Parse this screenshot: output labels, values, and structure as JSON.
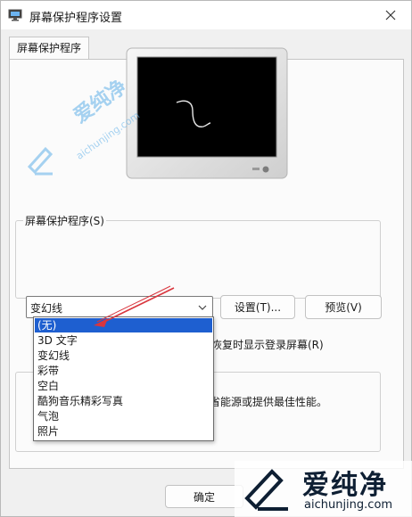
{
  "window": {
    "title": "屏幕保护程序设置",
    "tab_label": "屏幕保护程序"
  },
  "screensaver": {
    "group_title": "屏幕保护程序(S)",
    "selected_value": "变幻线",
    "settings_label": "设置(T)...",
    "preview_label": "预览(V)",
    "resume_text": "恢复时显示登录屏幕(R)",
    "options": [
      "(无)",
      "3D 文字",
      "变幻线",
      "彩带",
      "空白",
      "酷狗音乐精彩写真",
      "气泡",
      "照片"
    ],
    "highlighted_option": "(无)"
  },
  "power": {
    "text": "省能源或提供最佳性能。"
  },
  "footer": {
    "ok_label": "确定"
  },
  "watermark": {
    "brand": "爱纯净",
    "url": "aichunjing.com"
  },
  "colors": {
    "selection": "#1e5fd0",
    "annotation_arrow": "#d9363e",
    "watermark_blue": "#5fb0e8"
  }
}
